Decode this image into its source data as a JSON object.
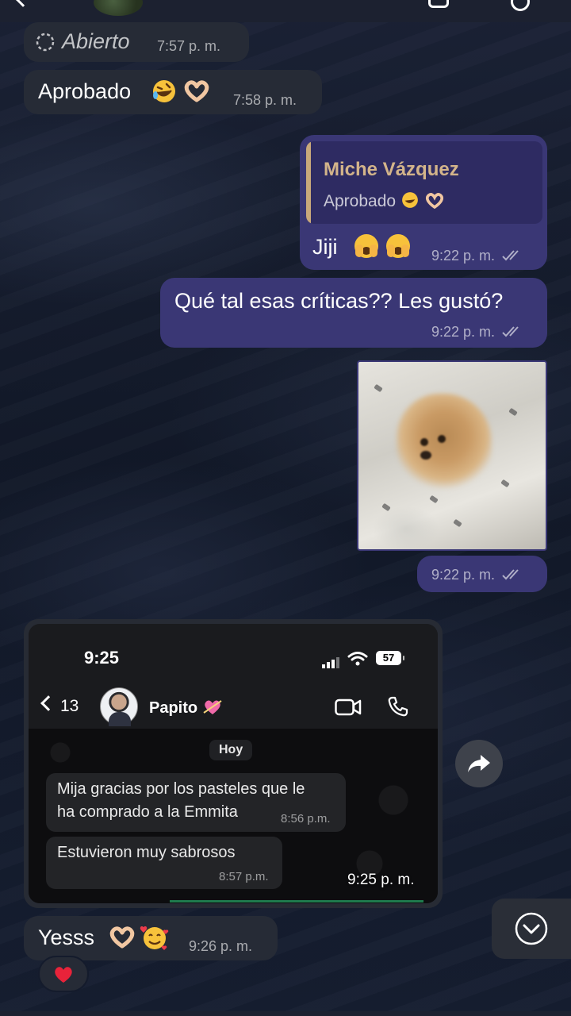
{
  "messages": {
    "status_in": {
      "text": "Abierto",
      "time": "7:57 p. m."
    },
    "aprobado_in": {
      "text": "Aprobado",
      "time": "7:58 p. m."
    },
    "reply_out": {
      "quote_author": "Miche Vázquez",
      "quote_text": "Aprobado",
      "text": "Jiji",
      "time": "9:22 p. m."
    },
    "question_out": {
      "text": "Qué tal esas críticas?? Les gustó?",
      "time": "9:22 p. m."
    },
    "photo_out": {
      "time": "9:22 p. m."
    },
    "yesss_in": {
      "text": "Yesss",
      "time": "9:26 p. m.",
      "reaction": "heart"
    }
  },
  "screenshot": {
    "clock": "9:25",
    "battery": "57",
    "back_count": "13",
    "contact_name": "Papito",
    "day_label": "Hoy",
    "msg1_line1": "Mija gracias por los pasteles que le",
    "msg1_line2": "ha comprado a la Emmita",
    "msg1_time": "8:56 p.m.",
    "msg2_text": "Estuvieron muy sabrosos",
    "msg2_time": "8:57 p.m.",
    "overlay_time": "9:25 p. m."
  },
  "colors": {
    "incoming_bubble": "#262b36",
    "outgoing_bubble": "#3a3775",
    "quote_author": "#d3b48a"
  },
  "icons": {
    "forward": "share-forward-icon",
    "scroll_down": "chevron-down-circle-icon",
    "read_receipt": "double-check-icon"
  }
}
